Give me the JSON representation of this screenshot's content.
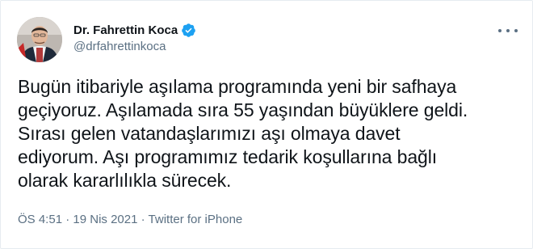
{
  "author": {
    "display_name": "Dr. Fahrettin Koca",
    "handle": "@drfahrettinkoca",
    "verified": true
  },
  "tweet": {
    "text": "Bugün itibariyle aşılama programında yeni bir safhaya\ngeçiyoruz. Aşılamada sıra 55 yaşından büyüklere geldi.\nSırası gelen vatandaşlarımızı aşı olmaya davet\nediyorum. Aşı programımız tedarik koşullarına bağlı\nolarak kararlılıkla sürecek.",
    "time": "ÖS 4:51",
    "separator": "·",
    "date": "19 Nis 2021",
    "source": "Twitter for iPhone"
  },
  "icons": {
    "verified": "verified-badge-icon",
    "more": "more-options-icon"
  },
  "colors": {
    "verified_blue": "#1da1f2",
    "secondary_text": "#5b7083",
    "primary_text": "#0f1419",
    "border": "#e6ecf0"
  }
}
